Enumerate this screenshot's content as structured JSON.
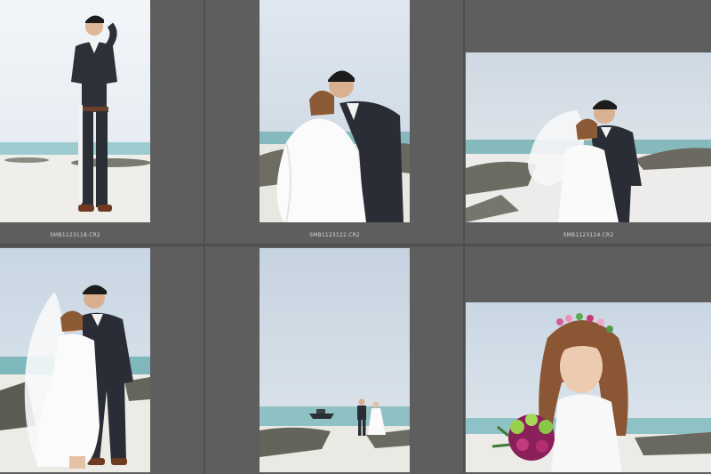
{
  "library": {
    "thumbnails": [
      {
        "filename": "SMB1123118.CR2",
        "subject": "groom-standing-portrait"
      },
      {
        "filename": "SMB1123122.CR2",
        "subject": "couple-laughing-beach"
      },
      {
        "filename": "SMB1123124.CR2",
        "subject": "couple-veil-wind"
      },
      {
        "filename": "",
        "subject": "couple-veil-embrace"
      },
      {
        "filename": "",
        "subject": "couple-walking-shore"
      },
      {
        "filename": "",
        "subject": "bride-flower-crown-bouquet"
      }
    ]
  },
  "colors": {
    "background": "#4f4f4f",
    "cell": "#5e5e5e",
    "caption": "#d8d8d8",
    "sky": "#d7e0ea",
    "sea": "#8fc3c8",
    "sand": "#ecebe6",
    "suit": "#2b2e36"
  }
}
